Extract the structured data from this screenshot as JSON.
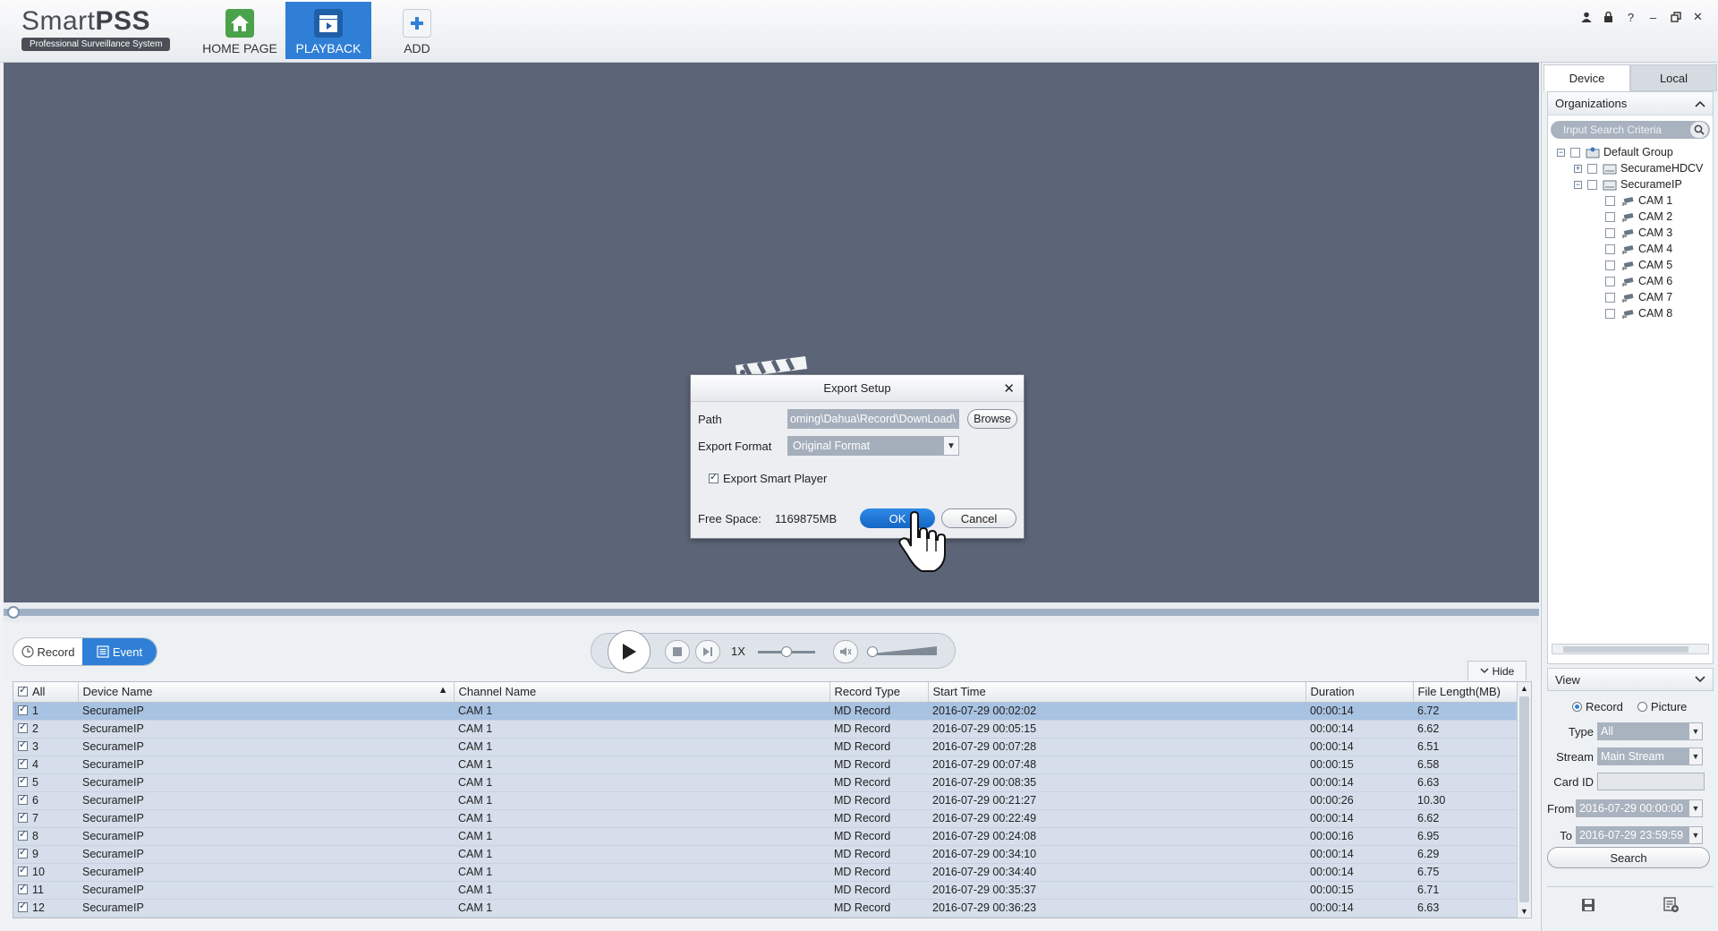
{
  "app": {
    "logo_main": "Smart",
    "logo_bold": "PSS",
    "logo_sub": "Professional Surveillance System"
  },
  "nav": [
    {
      "label": "HOME PAGE",
      "icon": "home-icon"
    },
    {
      "label": "PLAYBACK",
      "icon": "playback-icon",
      "active": true
    },
    {
      "label": "ADD",
      "icon": "add-icon"
    }
  ],
  "window_controls": [
    "user-icon",
    "lock-icon",
    "help-icon",
    "minimize-icon",
    "restore-icon",
    "close-icon"
  ],
  "controls": {
    "record_label": "Record",
    "event_label": "Event",
    "speed": "1X",
    "hide_label": "Hide"
  },
  "table": {
    "headers": [
      "All",
      "Device Name",
      "Channel Name",
      "Record Type",
      "Start Time",
      "Duration",
      "File Length(MB)"
    ],
    "rows": [
      {
        "no": "1",
        "device": "SecurameIP",
        "channel": "CAM 1",
        "type": "MD Record",
        "start": "2016-07-29 00:02:02",
        "duration": "00:00:14",
        "size": "6.72"
      },
      {
        "no": "2",
        "device": "SecurameIP",
        "channel": "CAM 1",
        "type": "MD Record",
        "start": "2016-07-29 00:05:15",
        "duration": "00:00:14",
        "size": "6.62"
      },
      {
        "no": "3",
        "device": "SecurameIP",
        "channel": "CAM 1",
        "type": "MD Record",
        "start": "2016-07-29 00:07:28",
        "duration": "00:00:14",
        "size": "6.51"
      },
      {
        "no": "4",
        "device": "SecurameIP",
        "channel": "CAM 1",
        "type": "MD Record",
        "start": "2016-07-29 00:07:48",
        "duration": "00:00:15",
        "size": "6.58"
      },
      {
        "no": "5",
        "device": "SecurameIP",
        "channel": "CAM 1",
        "type": "MD Record",
        "start": "2016-07-29 00:08:35",
        "duration": "00:00:14",
        "size": "6.63"
      },
      {
        "no": "6",
        "device": "SecurameIP",
        "channel": "CAM 1",
        "type": "MD Record",
        "start": "2016-07-29 00:21:27",
        "duration": "00:00:26",
        "size": "10.30"
      },
      {
        "no": "7",
        "device": "SecurameIP",
        "channel": "CAM 1",
        "type": "MD Record",
        "start": "2016-07-29 00:22:49",
        "duration": "00:00:14",
        "size": "6.62"
      },
      {
        "no": "8",
        "device": "SecurameIP",
        "channel": "CAM 1",
        "type": "MD Record",
        "start": "2016-07-29 00:24:08",
        "duration": "00:00:16",
        "size": "6.95"
      },
      {
        "no": "9",
        "device": "SecurameIP",
        "channel": "CAM 1",
        "type": "MD Record",
        "start": "2016-07-29 00:34:10",
        "duration": "00:00:14",
        "size": "6.29"
      },
      {
        "no": "10",
        "device": "SecurameIP",
        "channel": "CAM 1",
        "type": "MD Record",
        "start": "2016-07-29 00:34:40",
        "duration": "00:00:14",
        "size": "6.75"
      },
      {
        "no": "11",
        "device": "SecurameIP",
        "channel": "CAM 1",
        "type": "MD Record",
        "start": "2016-07-29 00:35:37",
        "duration": "00:00:15",
        "size": "6.71"
      },
      {
        "no": "12",
        "device": "SecurameIP",
        "channel": "CAM 1",
        "type": "MD Record",
        "start": "2016-07-29 00:36:23",
        "duration": "00:00:14",
        "size": "6.63"
      }
    ]
  },
  "right_panel": {
    "tab_device": "Device",
    "tab_local": "Local",
    "organizations_label": "Organizations",
    "search_placeholder": "Input Search Criteria",
    "tree": {
      "group": "Default Group",
      "device1": "SecurameHDCV",
      "device2": "SecurameIP",
      "cams": [
        "CAM 1",
        "CAM 2",
        "CAM 3",
        "CAM 4",
        "CAM 5",
        "CAM 6",
        "CAM 7",
        "CAM 8"
      ]
    },
    "view_label": "View",
    "record_radio": "Record",
    "picture_radio": "Picture",
    "type_label": "Type",
    "type_value": "All",
    "stream_label": "Stream",
    "stream_value": "Main Stream",
    "cardid_label": "Card ID",
    "cardid_value": "",
    "from_label": "From",
    "from_value": "2016-07-29 00:00:00",
    "to_label": "To",
    "to_value": "2016-07-29 23:59:59",
    "search_label": "Search"
  },
  "dialog": {
    "title": "Export Setup",
    "path_label": "Path",
    "path_value": "oming\\Dahua\\Record\\DownLoad\\",
    "browse_label": "Browse",
    "format_label": "Export Format",
    "format_value": "Original Format",
    "smart_player_label": "Export Smart Player",
    "free_space_label": "Free Space:",
    "free_space_value": "1169875MB",
    "ok_label": "OK",
    "cancel_label": "Cancel"
  },
  "colors": {
    "accent": "#2f7fd6",
    "video_bg": "#5c6577",
    "row_bg": "#d5deea",
    "row_selected": "#a8c2e2"
  }
}
